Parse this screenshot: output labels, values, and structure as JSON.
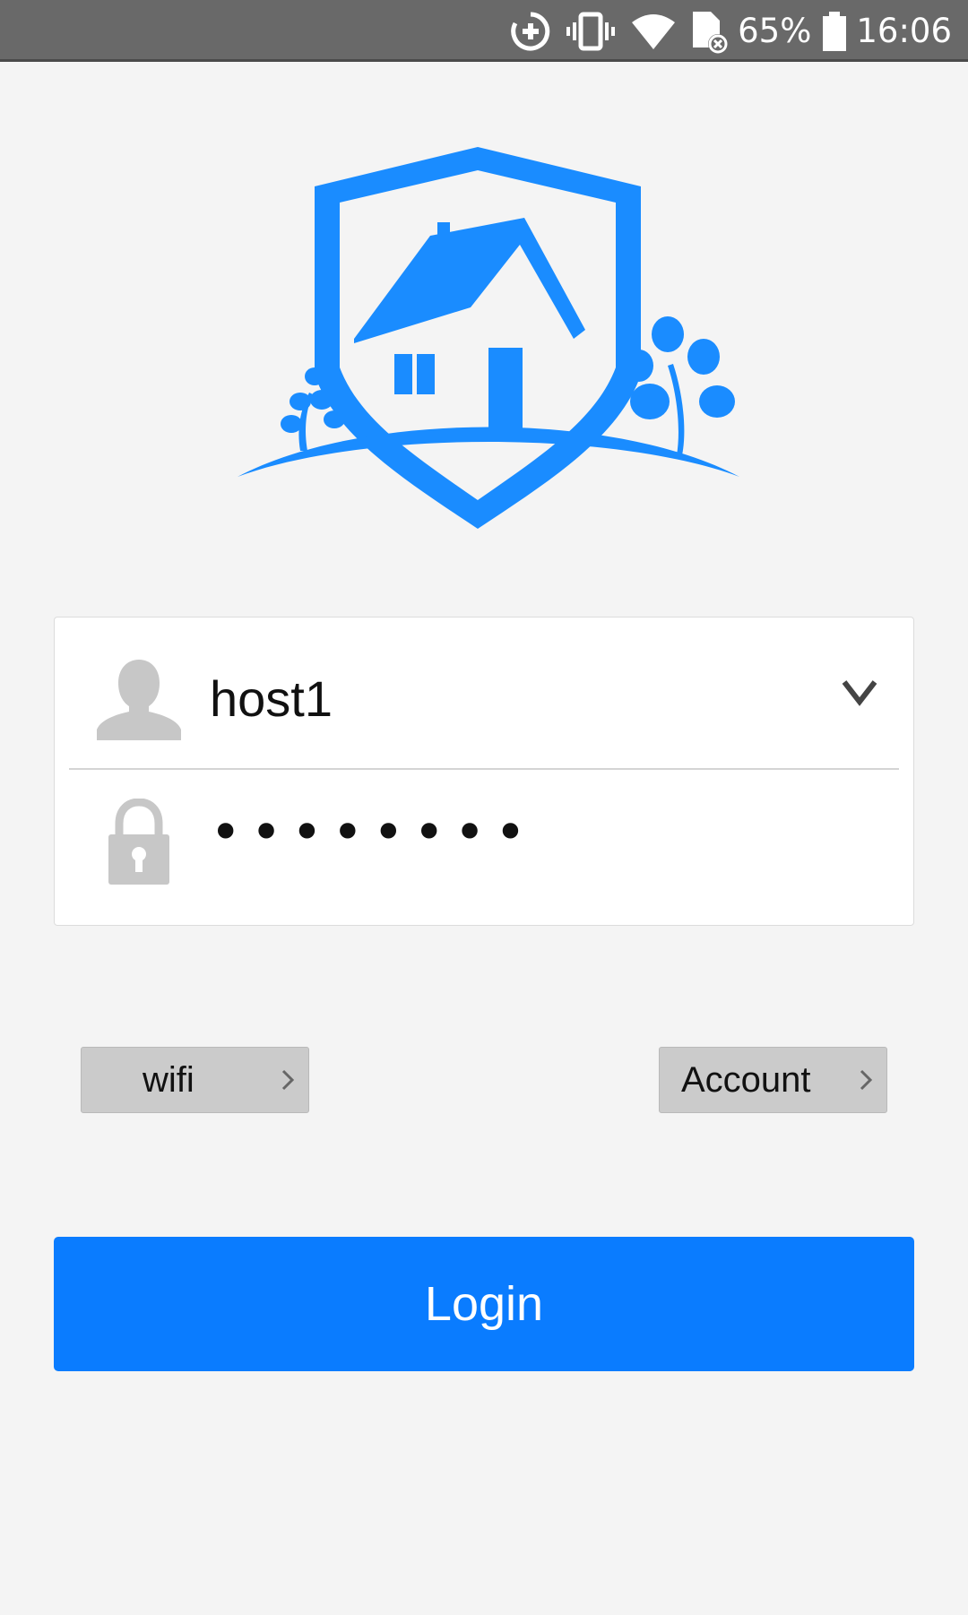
{
  "status_bar": {
    "battery": "65%",
    "time": "16:06",
    "icons": [
      "data-saver-icon",
      "vibrate-icon",
      "wifi-icon",
      "sim-missing-icon",
      "battery-icon"
    ]
  },
  "logo": {
    "name": "shield-house-logo",
    "color": "#1a8cff"
  },
  "form": {
    "username": "host1",
    "password_mask": "••••••••",
    "user_icon": "user-icon",
    "lock_icon": "lock-icon",
    "dropdown_icon": "chevron-down-icon"
  },
  "links": {
    "wifi_label": "wifi",
    "account_label": "Account"
  },
  "login_button": {
    "label": "Login",
    "color": "#0a7cff"
  }
}
